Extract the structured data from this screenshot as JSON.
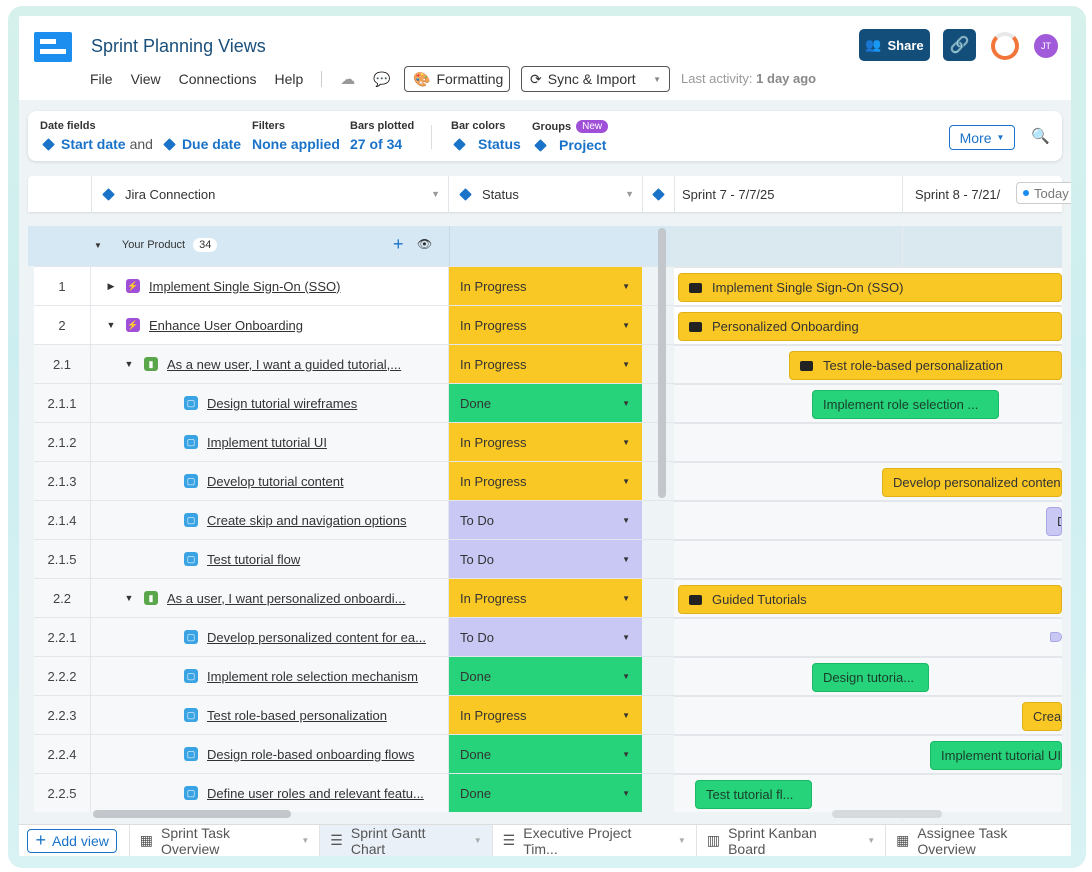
{
  "app": {
    "title": "Sprint Planning Views",
    "menu": [
      "File",
      "View",
      "Connections",
      "Help"
    ],
    "formatting_label": "Formatting",
    "sync_label": "Sync & Import",
    "last_activity_label": "Last activity:",
    "last_activity_value": "1 day ago",
    "share_label": "Share",
    "avatar_initials": "JT"
  },
  "toolbar": {
    "date_fields_label": "Date fields",
    "start_date": "Start date",
    "and_text": "and",
    "due_date": "Due date",
    "filters_label": "Filters",
    "filters_value": "None applied",
    "bars_label": "Bars plotted",
    "bars_value": "27 of 34",
    "bar_colors_label": "Bar colors",
    "bar_colors_value": "Status",
    "groups_label": "Groups",
    "groups_badge": "New",
    "groups_value": "Project",
    "more_label": "More"
  },
  "columns": {
    "jira": "Jira Connection",
    "status": "Status",
    "sprint7": "Sprint 7 - 7/7/25",
    "sprint8": "Sprint 8 - 7/21/",
    "today": "Today"
  },
  "group": {
    "name": "Your Product",
    "count": "34"
  },
  "rows": [
    {
      "num": "1",
      "name": "Implement Single Sign-On (SSO)",
      "status": "In Progress"
    },
    {
      "num": "2",
      "name": "Enhance User Onboarding",
      "status": "In Progress"
    },
    {
      "num": "2.1",
      "name": "As a new user, I want a guided tutorial,...",
      "status": "In Progress"
    },
    {
      "num": "2.1.1",
      "name": "Design tutorial wireframes",
      "status": "Done"
    },
    {
      "num": "2.1.2",
      "name": "Implement tutorial UI",
      "status": "In Progress"
    },
    {
      "num": "2.1.3",
      "name": "Develop tutorial content",
      "status": "In Progress"
    },
    {
      "num": "2.1.4",
      "name": "Create skip and navigation options",
      "status": "To Do"
    },
    {
      "num": "2.1.5",
      "name": "Test tutorial flow",
      "status": "To Do"
    },
    {
      "num": "2.2",
      "name": "As a user, I want personalized onboardi...",
      "status": "In Progress"
    },
    {
      "num": "2.2.1",
      "name": "Develop personalized content for ea...",
      "status": "To Do"
    },
    {
      "num": "2.2.2",
      "name": "Implement role selection mechanism",
      "status": "Done"
    },
    {
      "num": "2.2.3",
      "name": "Test role-based personalization",
      "status": "In Progress"
    },
    {
      "num": "2.2.4",
      "name": "Design role-based onboarding flows",
      "status": "Done"
    },
    {
      "num": "2.2.5",
      "name": "Define user roles and relevant featu...",
      "status": "Done"
    }
  ],
  "bars": {
    "b1": "Implement Single Sign-On (SSO)",
    "b2": "Personalized Onboarding",
    "b3": "Test role-based personalization",
    "b4": "Implement role selection ...",
    "b6": "Develop personalized content...",
    "b7": "De...",
    "b9": "Guided Tutorials",
    "b11": "Design tutoria...",
    "b12": "Create",
    "b13": "Implement tutorial UI",
    "b14": "Test tutorial fl..."
  },
  "tabs": {
    "add_view": "Add view",
    "t1": "Sprint Task Overview",
    "t2": "Sprint Gantt Chart",
    "t3": "Executive Project Tim...",
    "t4": "Sprint Kanban Board",
    "t5": "Assignee Task Overview"
  },
  "colors": {
    "in_progress": "#fac824",
    "done": "#27d37a",
    "to_do": "#c9c8f5",
    "accent": "#1a73c8",
    "header_button": "#134e7a"
  }
}
